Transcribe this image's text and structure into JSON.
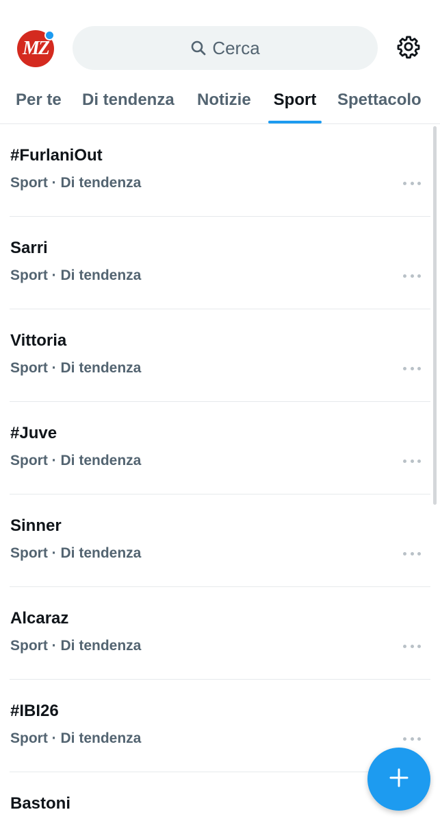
{
  "header": {
    "avatar_text": "MZ",
    "search_placeholder": "Cerca"
  },
  "tabs": [
    {
      "label": "Per te",
      "active": false
    },
    {
      "label": "Di tendenza",
      "active": false
    },
    {
      "label": "Notizie",
      "active": false
    },
    {
      "label": "Sport",
      "active": true
    },
    {
      "label": "Spettacolo",
      "active": false
    }
  ],
  "trends": [
    {
      "title": "#FurlaniOut",
      "meta": "Sport · Di tendenza"
    },
    {
      "title": "Sarri",
      "meta": "Sport · Di tendenza"
    },
    {
      "title": "Vittoria",
      "meta": "Sport · Di tendenza"
    },
    {
      "title": "#Juve",
      "meta": "Sport · Di tendenza"
    },
    {
      "title": "Sinner",
      "meta": "Sport · Di tendenza"
    },
    {
      "title": "Alcaraz",
      "meta": "Sport · Di tendenza"
    },
    {
      "title": "#IBI26",
      "meta": "Sport · Di tendenza"
    },
    {
      "title": "Bastoni",
      "meta": ""
    }
  ],
  "icons": {
    "search": "search-icon",
    "settings": "gear-icon",
    "more": "more-horizontal-icon",
    "compose": "plus-icon"
  },
  "colors": {
    "accent": "#1d9bf0",
    "avatar_bg": "#d42a1f",
    "secondary_text": "#536471"
  }
}
